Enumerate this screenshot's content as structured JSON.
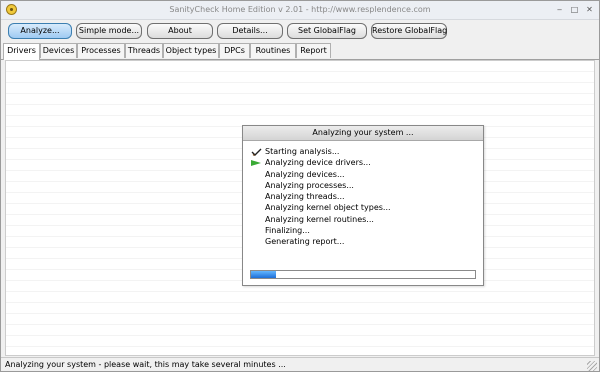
{
  "window": {
    "title": "SanityCheck Home Edition  v 2.01   -  http://www.resplendence.com",
    "minimize": "‒",
    "maximize": "□",
    "close": "✕"
  },
  "toolbar": {
    "buttons": [
      {
        "label": "Analyze...",
        "active": true
      },
      {
        "label": "Simple mode..."
      },
      {
        "label": "About"
      },
      {
        "label": "Details..."
      },
      {
        "label": "Set GlobalFlag"
      },
      {
        "label": "Restore GlobalFlag"
      }
    ]
  },
  "tabs": [
    {
      "label": "Drivers",
      "active": true
    },
    {
      "label": "Devices"
    },
    {
      "label": "Processes"
    },
    {
      "label": "Threads"
    },
    {
      "label": "Object types"
    },
    {
      "label": "DPCs"
    },
    {
      "label": "Routines"
    },
    {
      "label": "Report"
    }
  ],
  "dialog": {
    "title": "Analyzing your system ...",
    "steps": [
      {
        "label": "Starting analysis...",
        "icon": "checkmark-icon",
        "state": "done"
      },
      {
        "label": "Analyzing device drivers...",
        "icon": "arrow-right-icon",
        "state": "current"
      },
      {
        "label": "Analyzing devices...",
        "state": "pending"
      },
      {
        "label": "Analyzing processes...",
        "state": "pending"
      },
      {
        "label": "Analyzing threads...",
        "state": "pending"
      },
      {
        "label": "Analyzing kernel object types...",
        "state": "pending"
      },
      {
        "label": "Analyzing kernel routines...",
        "state": "pending"
      },
      {
        "label": "Finalizing...",
        "state": "pending"
      },
      {
        "label": "Generating report...",
        "state": "pending"
      }
    ],
    "progress_fraction": 0.11
  },
  "status": {
    "text": "Analyzing your system - please wait, this may take several minutes ..."
  },
  "colors": {
    "progress_fill": "#1d6fd8",
    "active_button": "#9fcaf2",
    "current_step_arrow": "#3aaa35"
  }
}
